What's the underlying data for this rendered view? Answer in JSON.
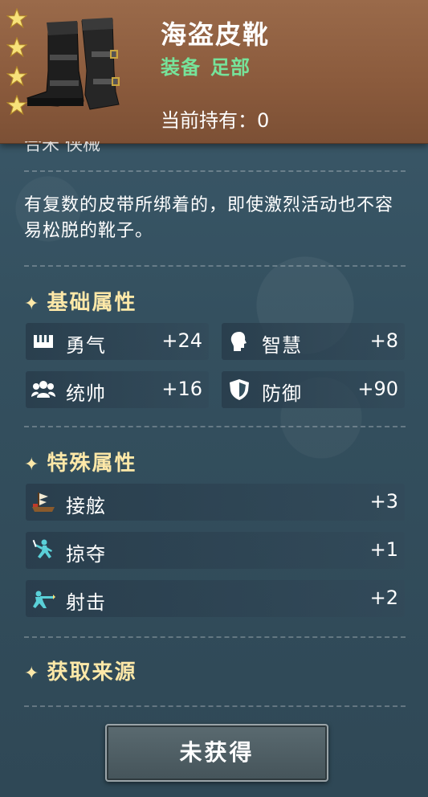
{
  "item": {
    "name": "海盗皮靴",
    "category": "装备",
    "slot": "足部",
    "holding_label": "当前持有：",
    "holding_value": "0",
    "stars": 4
  },
  "cut_text": "合米 侠械",
  "description": "有复数的皮带所绑着的，即使激烈活动也不容易松脱的靴子。",
  "sections": {
    "basic_title": "基础属性",
    "special_title": "特殊属性",
    "source_title": "获取来源"
  },
  "basic_attrs": [
    {
      "name": "勇气",
      "value": "+24",
      "icon": "courage-icon"
    },
    {
      "name": "智慧",
      "value": "+8",
      "icon": "wisdom-icon"
    },
    {
      "name": "统帅",
      "value": "+16",
      "icon": "command-icon"
    },
    {
      "name": "防御",
      "value": "+90",
      "icon": "shield-icon"
    }
  ],
  "special_attrs": [
    {
      "name": "接舷",
      "value": "+3",
      "icon": "boarding-icon"
    },
    {
      "name": "掠夺",
      "value": "+1",
      "icon": "plunder-icon"
    },
    {
      "name": "射击",
      "value": "+2",
      "icon": "shooting-icon"
    }
  ],
  "button": {
    "label": "未获得"
  },
  "colors": {
    "title": "#ffffff",
    "type": "#76e39a",
    "section": "#fde8a8",
    "header": "#8a5a3c",
    "panel": "#34505f"
  }
}
